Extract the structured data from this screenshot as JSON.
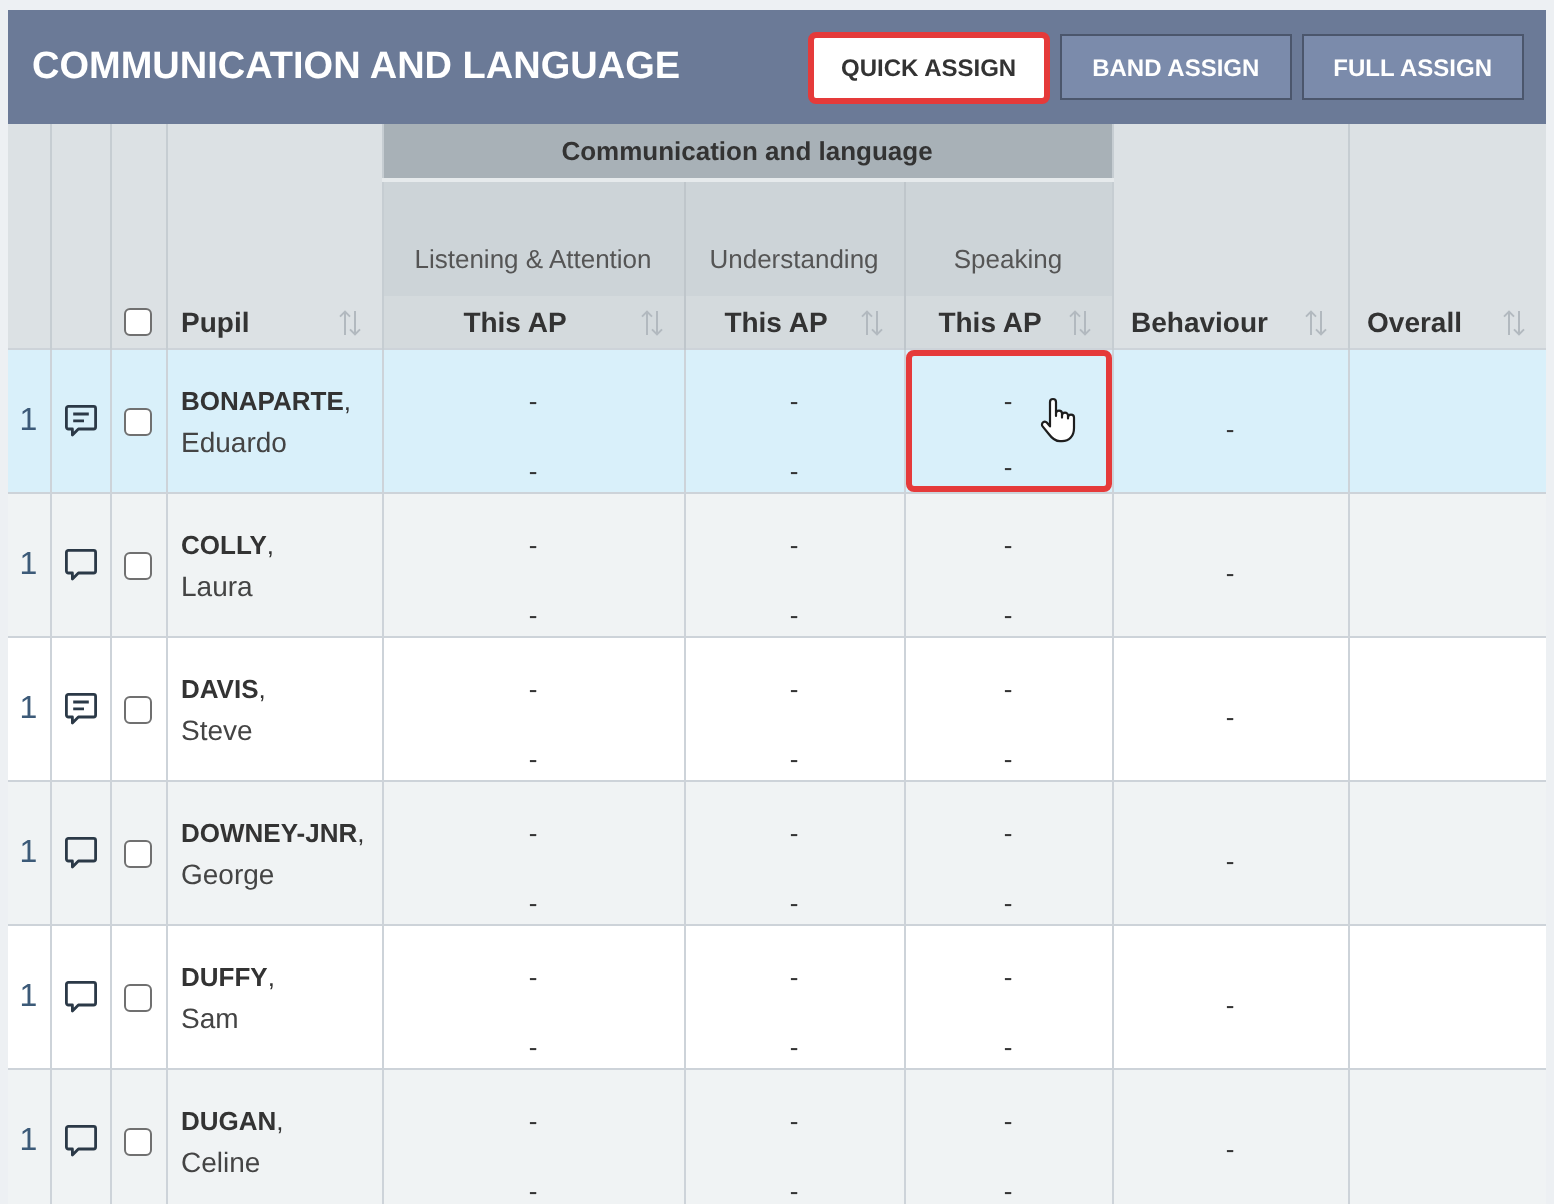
{
  "header": {
    "title": "COMMUNICATION AND LANGUAGE",
    "buttons": [
      {
        "label": "QUICK ASSIGN",
        "selected": true,
        "highlighted": true
      },
      {
        "label": "BAND ASSIGN",
        "selected": false,
        "highlighted": false
      },
      {
        "label": "FULL ASSIGN",
        "selected": false,
        "highlighted": false
      }
    ]
  },
  "table": {
    "select_all_checked": false,
    "pupil_column": "Pupil",
    "group_heading": "Communication and language",
    "assessment_columns": [
      {
        "label": "Listening & Attention",
        "sublabel": "This AP"
      },
      {
        "label": "Understanding",
        "sublabel": "This AP"
      },
      {
        "label": "Speaking",
        "sublabel": "This AP"
      }
    ],
    "behaviour_column": "Behaviour",
    "overall_column": "Overall",
    "rows": [
      {
        "number": "1",
        "has_comment": true,
        "checked": false,
        "hovered": true,
        "surname": "**BONAPARTE**,",
        "first_name": "Eduardo",
        "scores": [
          {
            "top": "-",
            "bottom": "-",
            "highlighted": false
          },
          {
            "top": "-",
            "bottom": "-",
            "highlighted": false
          },
          {
            "top": "-",
            "bottom": "-",
            "highlighted": true
          }
        ],
        "behaviour": "-"
      },
      {
        "number": "1",
        "has_comment": false,
        "checked": false,
        "hovered": false,
        "surname": "**COLLY**,",
        "first_name": "Laura",
        "scores": [
          {
            "top": "-",
            "bottom": "-",
            "highlighted": false
          },
          {
            "top": "-",
            "bottom": "-",
            "highlighted": false
          },
          {
            "top": "-",
            "bottom": "-",
            "highlighted": false
          }
        ],
        "behaviour": "-"
      },
      {
        "number": "1",
        "has_comment": true,
        "checked": false,
        "hovered": false,
        "surname": "**DAVIS**,",
        "first_name": "Steve",
        "scores": [
          {
            "top": "-",
            "bottom": "-",
            "highlighted": false
          },
          {
            "top": "-",
            "bottom": "-",
            "highlighted": false
          },
          {
            "top": "-",
            "bottom": "-",
            "highlighted": false
          }
        ],
        "behaviour": "-"
      },
      {
        "number": "1",
        "has_comment": false,
        "checked": false,
        "hovered": false,
        "surname": "**DOWNEY-JNR**,",
        "first_name": "George",
        "scores": [
          {
            "top": "-",
            "bottom": "-",
            "highlighted": false
          },
          {
            "top": "-",
            "bottom": "-",
            "highlighted": false
          },
          {
            "top": "-",
            "bottom": "-",
            "highlighted": false
          }
        ],
        "behaviour": "-"
      },
      {
        "number": "1",
        "has_comment": false,
        "checked": false,
        "hovered": false,
        "surname": "**DUFFY**,",
        "first_name": "Sam",
        "scores": [
          {
            "top": "-",
            "bottom": "-",
            "highlighted": false
          },
          {
            "top": "-",
            "bottom": "-",
            "highlighted": false
          },
          {
            "top": "-",
            "bottom": "-",
            "highlighted": false
          }
        ],
        "behaviour": "-"
      },
      {
        "number": "1",
        "has_comment": false,
        "checked": false,
        "hovered": false,
        "surname": "**DUGAN**,",
        "first_name": "Celine",
        "scores": [
          {
            "top": "-",
            "bottom": "-",
            "highlighted": false
          },
          {
            "top": "-",
            "bottom": "-",
            "highlighted": false
          },
          {
            "top": "-",
            "bottom": "-",
            "highlighted": false
          }
        ],
        "behaviour": "-"
      }
    ]
  }
}
